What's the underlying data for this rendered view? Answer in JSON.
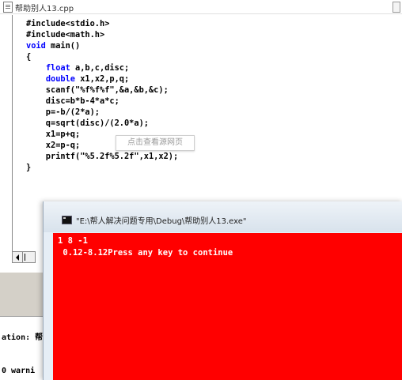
{
  "editor": {
    "title": "帮助别人13.cpp",
    "code": [
      {
        "kw": "",
        "text": "#include<stdio.h>"
      },
      {
        "kw": "",
        "text": "#include<math.h>"
      },
      {
        "kw": "void",
        "text": " main()"
      },
      {
        "kw": "",
        "text": "{"
      },
      {
        "kw": "",
        "text": "    ",
        "kw2": "float",
        "text2": " a,b,c,disc;"
      },
      {
        "kw": "",
        "text": "    ",
        "kw2": "double",
        "text2": " x1,x2,p,q;"
      },
      {
        "kw": "",
        "text": "    scanf(\"%f%f%f\",&a,&b,&c);"
      },
      {
        "kw": "",
        "text": "    disc=b*b-4*a*c;"
      },
      {
        "kw": "",
        "text": "    p=-b/(2*a);"
      },
      {
        "kw": "",
        "text": "    q=sqrt(disc)/(2.0*a);"
      },
      {
        "kw": "",
        "text": "    x1=p+q;"
      },
      {
        "kw": "",
        "text": "    x2=p-q;"
      },
      {
        "kw": "",
        "text": "    printf(\"%5.2f%5.2f\",x1,x2);"
      },
      {
        "kw": "",
        "text": "}"
      }
    ],
    "tooltip": "点击查看源网页"
  },
  "output_pane": {
    "line1": "ation: 帮",
    "line2": "0 warni"
  },
  "console": {
    "title": "\"E:\\帮人解决问题专用\\Debug\\帮助别人13.exe\"",
    "lines": [
      "1 8 -1",
      " 0.12-8.12Press any key to continue"
    ],
    "background_color": "#ff0000",
    "text_color": "#ffffff"
  }
}
